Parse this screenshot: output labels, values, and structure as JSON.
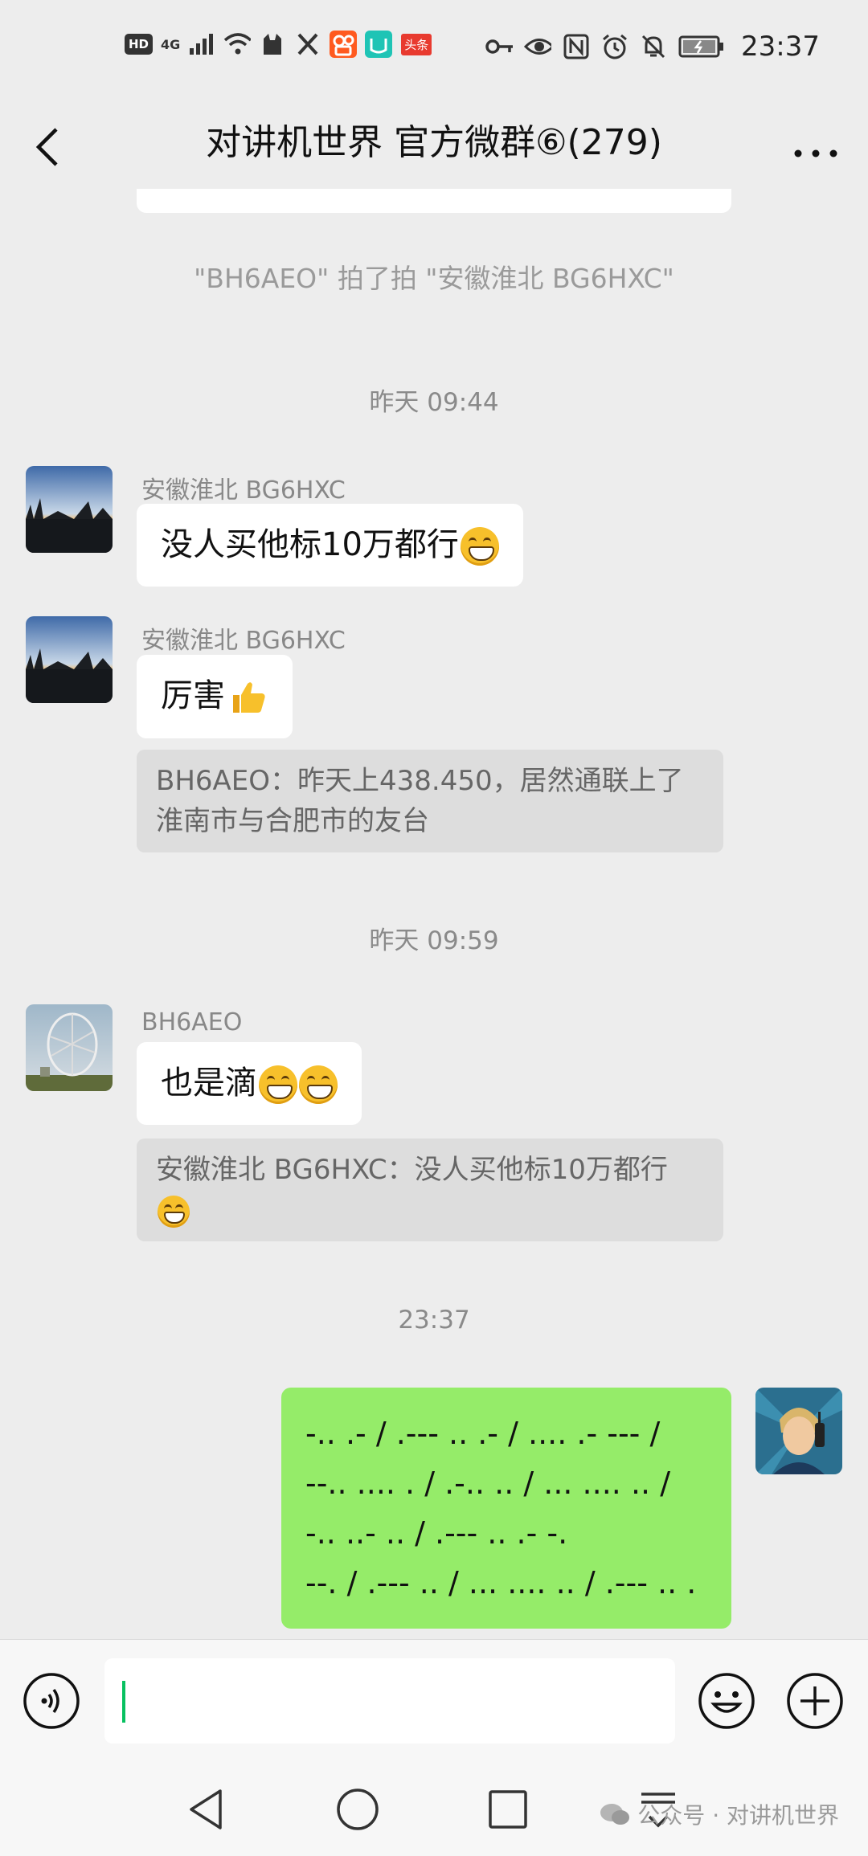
{
  "status_bar": {
    "left_badges": [
      "HD",
      "4G"
    ],
    "carrier_badge": "头条",
    "time": "23:37"
  },
  "header": {
    "title": "对讲机世界 官方微群⑥(279)"
  },
  "chat": {
    "system_notice": "\"BH6AEO\" 拍了拍 \"安徽淮北 BG6HXC\"",
    "messages": [
      {
        "timestamp": "昨天 09:44"
      },
      {
        "sender": "安徽淮北 BG6HXC",
        "text": "没人买他标10万都行"
      },
      {
        "sender": "安徽淮北 BG6HXC",
        "text": "厉害",
        "quote": "BH6AEO：昨天上438.450，居然通联上了淮南市与合肥市的友台"
      },
      {
        "timestamp": "昨天 09:59"
      },
      {
        "sender": "BH6AEO",
        "text": "也是滴",
        "quote": "安徽淮北 BG6HXC：没人买他标10万都行"
      },
      {
        "timestamp": "23:37"
      },
      {
        "sender": "me",
        "text": "-.. .- / .--- .. .- / .... .- --- /\n--.. .... . / .-.. .. / ... .... .. /\n-.. ..- .. / .--- .. .- -.\n--. / .--- .. / ... .... .. / .--- .. ."
      }
    ]
  },
  "input_bar": {
    "value": ""
  },
  "watermark": "公众号 · 对讲机世界",
  "icons": {
    "back": "chevron-left-icon",
    "more": "more-dots-icon",
    "voice": "voice-icon",
    "emoji": "emoji-icon",
    "plus": "plus-icon",
    "nav_back": "nav-back-icon",
    "nav_home": "nav-home-icon",
    "nav_recent": "nav-recent-icon"
  },
  "colors": {
    "my_bubble": "#95ec69",
    "caret": "#07c160",
    "background": "#ededed"
  }
}
